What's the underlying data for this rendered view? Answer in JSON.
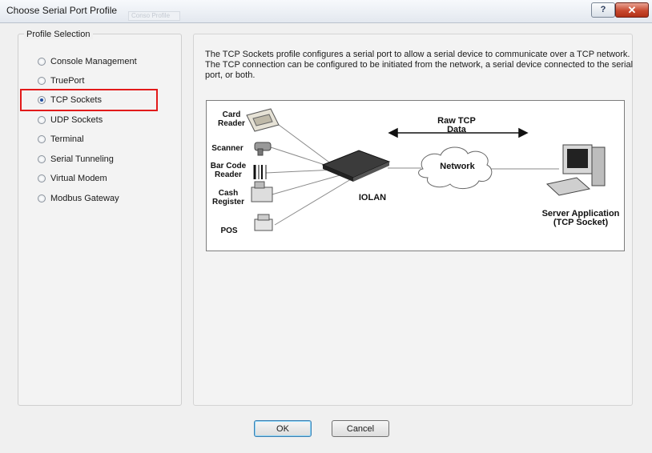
{
  "window": {
    "title": "Choose Serial Port Profile",
    "help_label": "?",
    "close_label": "✕",
    "ghost_text": "Conso Profile"
  },
  "profile_group": {
    "label": "Profile Selection",
    "options": [
      {
        "label": "Console Management",
        "checked": false
      },
      {
        "label": "TruePort",
        "checked": false
      },
      {
        "label": "TCP Sockets",
        "checked": true
      },
      {
        "label": "UDP Sockets",
        "checked": false
      },
      {
        "label": "Terminal",
        "checked": false
      },
      {
        "label": "Serial Tunneling",
        "checked": false
      },
      {
        "label": "Virtual Modem",
        "checked": false
      },
      {
        "label": "Modbus Gateway",
        "checked": false
      }
    ]
  },
  "description": {
    "lines": [
      "The TCP Sockets profile configures a serial port to allow a serial device to communicate over a TCP network.",
      "The TCP connection can be configured to be initiated from the network, a serial device connected to the serial",
      "port, or both."
    ]
  },
  "diagram": {
    "card_reader": "Card\nReader",
    "scanner": "Scanner",
    "bar_code_reader": "Bar Code\nReader",
    "cash_register": "Cash\nRegister",
    "pos": "POS",
    "iolan": "IOLAN",
    "raw_tcp": "Raw TCP\nData",
    "network": "Network",
    "server": "Server Application\n(TCP Socket)"
  },
  "buttons": {
    "ok": "OK",
    "cancel": "Cancel"
  },
  "colors": {
    "highlight": "#e21a1a",
    "radio_dot": "#1f4ea3"
  }
}
